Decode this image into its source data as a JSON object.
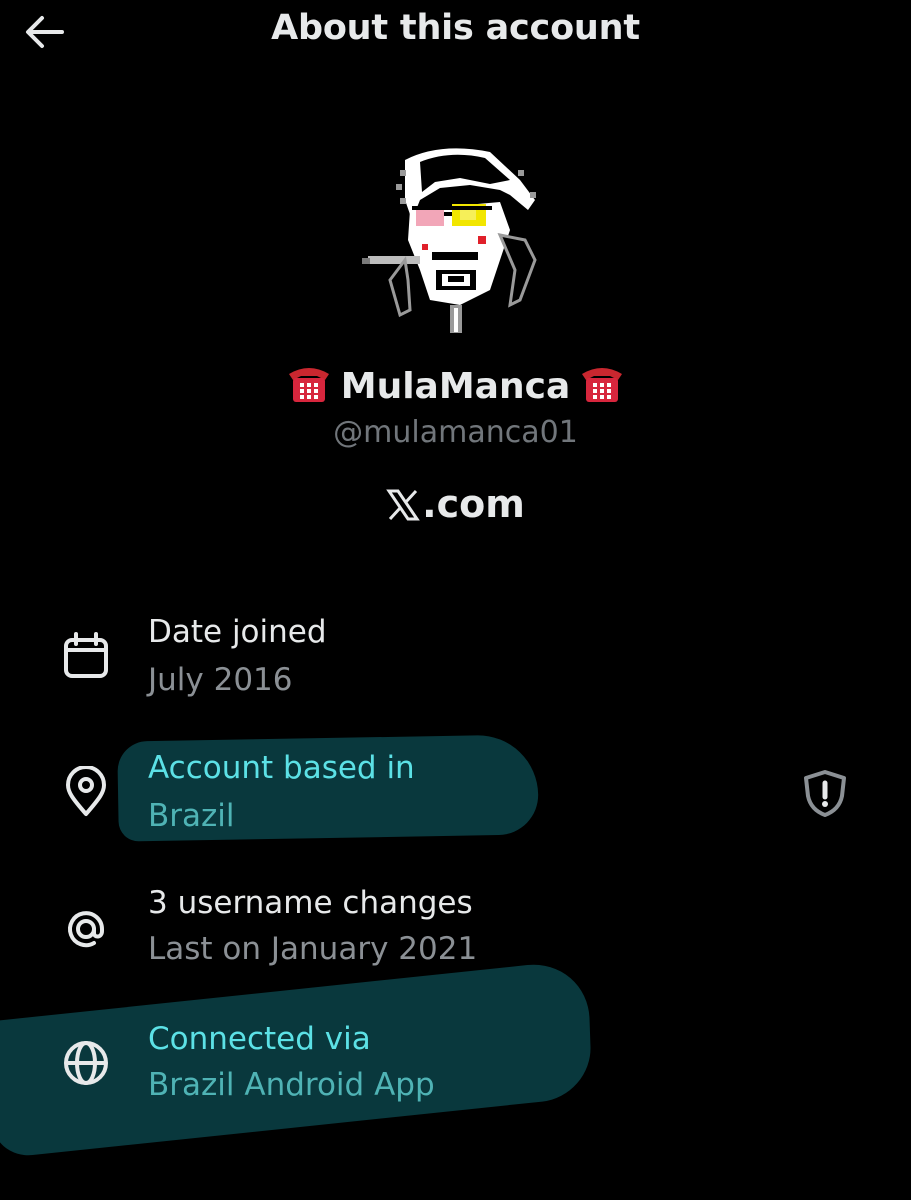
{
  "header": {
    "title": "About this account",
    "back_icon": "arrow-left-icon"
  },
  "profile": {
    "display_name": "MulaManca",
    "name_decoration_icon": "telephone-emoji",
    "handle": "@mulamanca01",
    "platform": ".com",
    "platform_logo_icon": "x-logo-icon"
  },
  "details": [
    {
      "label": "Date joined",
      "value": "July 2016",
      "icon": "calendar-icon"
    },
    {
      "label": "Account based in",
      "value": "Brazil",
      "icon": "location-pin-icon",
      "highlighted": true
    },
    {
      "label": "3 username changes",
      "value": "Last on January 2021",
      "icon": "at-sign-icon"
    },
    {
      "label": "Connected via",
      "value": "Brazil Android App",
      "icon": "globe-icon",
      "highlighted": true
    }
  ],
  "actions": {
    "info_icon": "shield-alert-icon"
  },
  "colors": {
    "background": "#000000",
    "text": "#e7e9ea",
    "muted": "#71767b",
    "accent": "#5ce1e6",
    "highlight": "#0a3b40",
    "phone": "#d7263d"
  }
}
